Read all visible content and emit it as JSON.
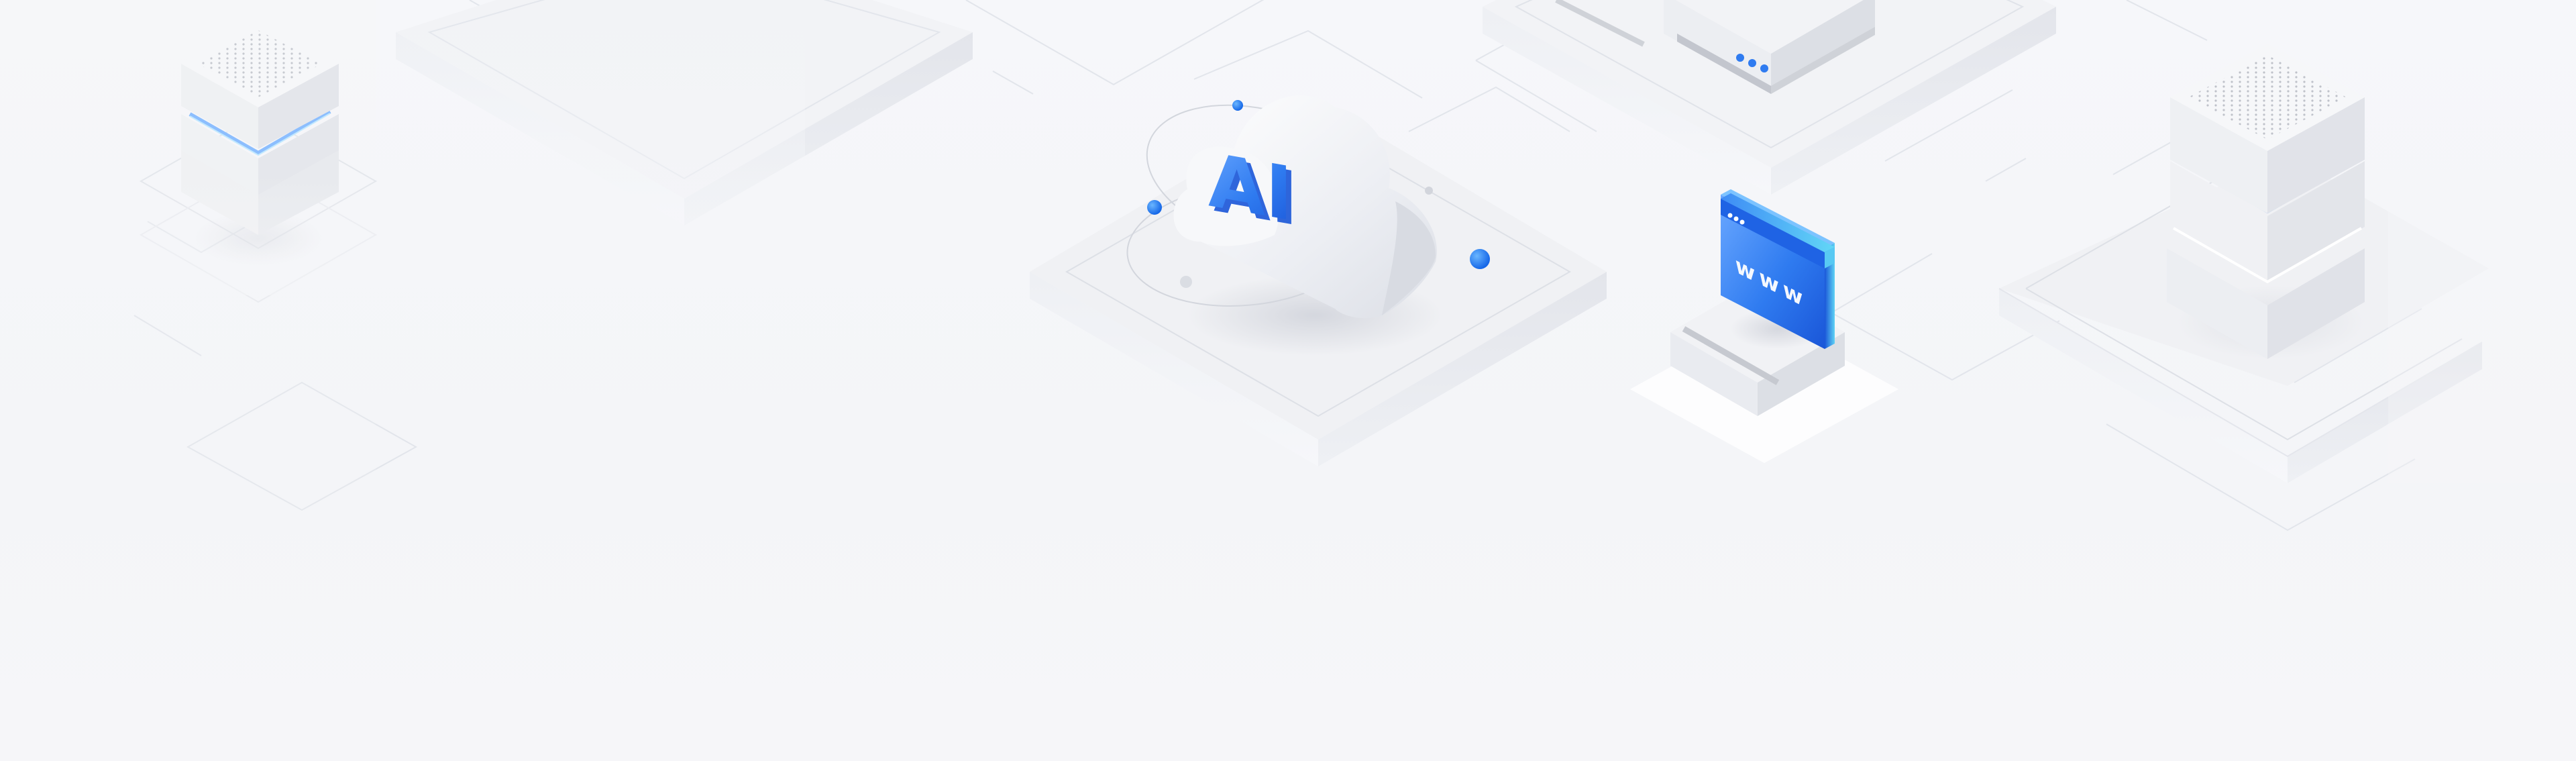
{
  "scene": {
    "cloud_badge": {
      "text": "AI",
      "icon": "ai-cloud-icon"
    },
    "browser_window": {
      "text": "www",
      "icon": "web-browser-icon"
    },
    "server_left": {
      "icon": "server-stack-icon"
    },
    "server_right": {
      "icon": "server-stack-icon"
    },
    "server_top": {
      "icon": "server-icon"
    }
  },
  "colors": {
    "background": "#f5f6f9",
    "accent_blue": "#2f7bf0",
    "accent_cyan": "#5fd3f5",
    "accent_dark_blue": "#1a56d8",
    "platform_top": "#f1f2f5",
    "platform_side": "#e4e6ec",
    "line": "#dfe2e8"
  }
}
